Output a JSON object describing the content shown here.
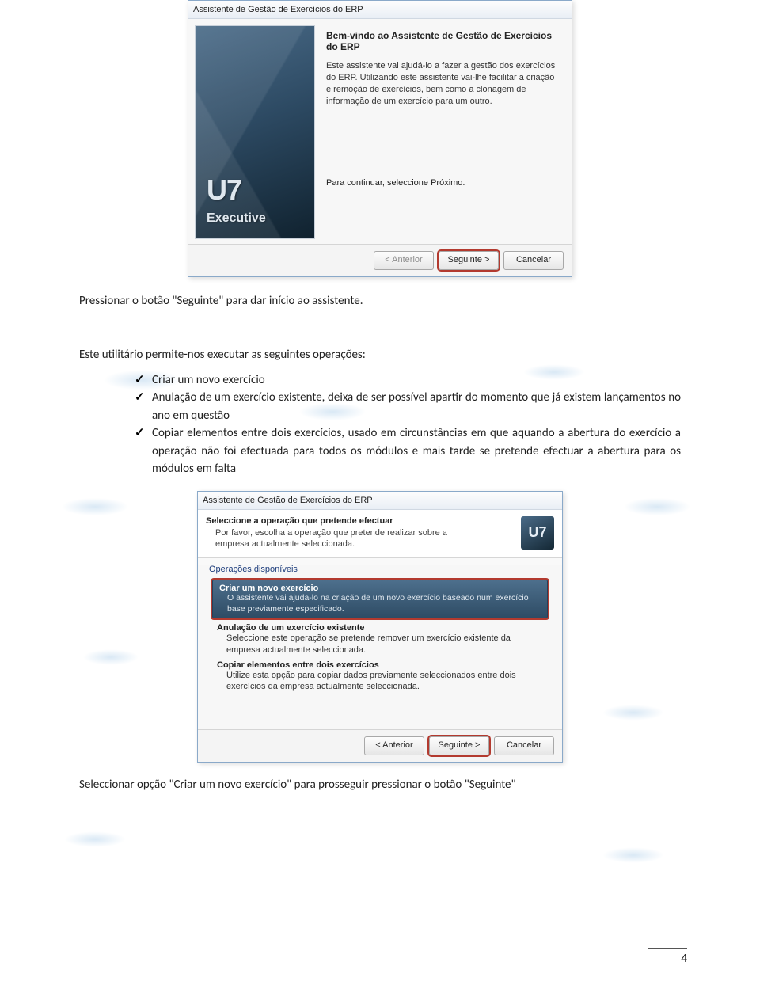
{
  "dialog1": {
    "title": "Assistente de Gestão de Exercícios do ERP",
    "side_brand_short": "U7",
    "side_brand_full": "Executive",
    "heading": "Bem-vindo ao Assistente de Gestão de Exercícios do ERP",
    "body": "Este assistente vai ajudá-lo a fazer a gestão dos exercícios do ERP. Utilizando este assistente vai-lhe facilitar a criação e remoção de exercícios, bem como a clonagem de informação de um exercício para um outro.",
    "continue_text": "Para continuar, seleccione Próximo.",
    "btn_back": "< Anterior",
    "btn_next": "Seguinte >",
    "btn_cancel": "Cancelar"
  },
  "body_text": {
    "p1": "Pressionar o botão \"Seguinte\" para dar início ao assistente.",
    "p2": "Este utilitário permite-nos executar as seguintes operações:",
    "li1": "Criar um novo exercício",
    "li2": "Anulação de um exercício existente, deixa de ser possível apartir do momento que já existem lançamentos no ano em questão",
    "li3": "Copiar elementos entre dois exercícios, usado em circunstâncias em que aquando a abertura do exercício a operação não foi efectuada para todos os módulos e mais tarde se pretende efectuar a abertura para os módulos em falta",
    "p3": "Seleccionar opção \"Criar um novo exercício\" para prosseguir pressionar o botão \"Seguinte\""
  },
  "dialog2": {
    "title": "Assistente de Gestão de Exercícios do ERP",
    "head_title": "Seleccione a operação que pretende efectuar",
    "head_sub": "Por favor, escolha a operação que pretende realizar sobre a empresa actualmente seleccionada.",
    "logo_short": "U7",
    "group_label": "Operações disponíveis",
    "opt1_title": "Criar um novo exercício",
    "opt1_desc": "O assistente vai ajuda-lo na criação de um novo exercício baseado num exercício base previamente especificado.",
    "opt2_title": "Anulação de um exercício existente",
    "opt2_desc": "Seleccione este operação se pretende remover um exercício existente da empresa actualmente seleccionada.",
    "opt3_title": "Copiar elementos entre dois exercícios",
    "opt3_desc": "Utilize esta opção para copiar dados previamente seleccionados entre dois exercícios da empresa actualmente seleccionada.",
    "btn_back": "< Anterior",
    "btn_next": "Seguinte >",
    "btn_cancel": "Cancelar"
  },
  "page_number": "4"
}
